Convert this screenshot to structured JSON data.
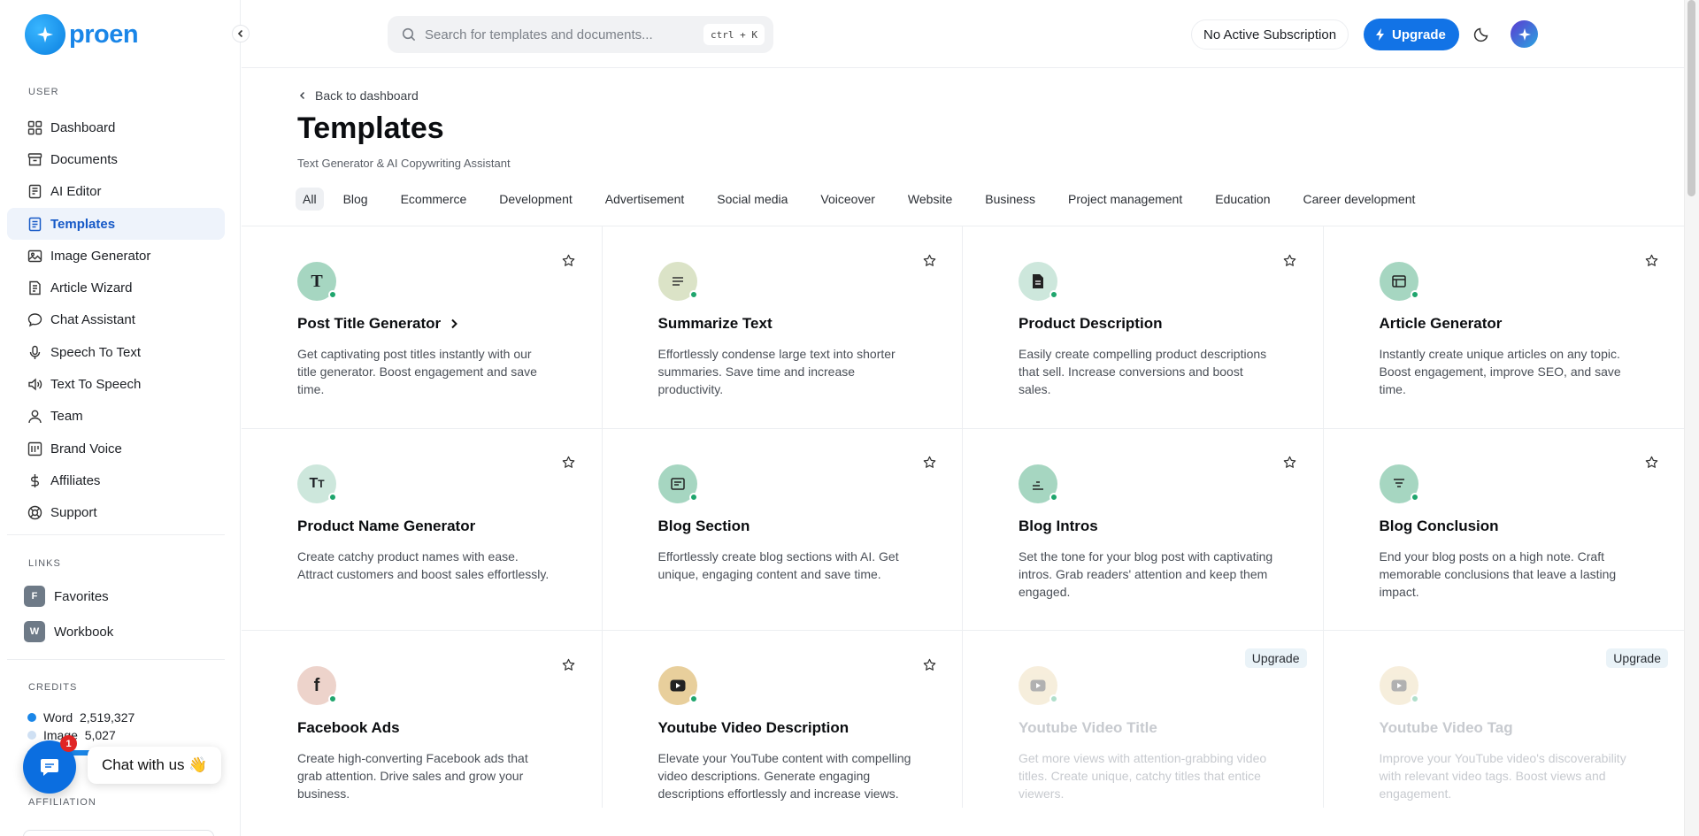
{
  "brand": {
    "name": "proen"
  },
  "sidebar": {
    "user_label": "USER",
    "items": [
      {
        "label": "Dashboard",
        "icon": "dashboard-icon"
      },
      {
        "label": "Documents",
        "icon": "documents-icon"
      },
      {
        "label": "AI Editor",
        "icon": "editor-icon"
      },
      {
        "label": "Templates",
        "icon": "templates-icon",
        "active": true
      },
      {
        "label": "Image Generator",
        "icon": "image-icon"
      },
      {
        "label": "Article Wizard",
        "icon": "wizard-icon"
      },
      {
        "label": "Chat Assistant",
        "icon": "chat-icon"
      },
      {
        "label": "Speech To Text",
        "icon": "mic-icon"
      },
      {
        "label": "Text To Speech",
        "icon": "speaker-icon"
      },
      {
        "label": "Team",
        "icon": "team-icon"
      },
      {
        "label": "Brand Voice",
        "icon": "brand-icon"
      },
      {
        "label": "Affiliates",
        "icon": "dollar-icon"
      },
      {
        "label": "Support",
        "icon": "support-icon"
      }
    ],
    "links_label": "LINKS",
    "links": [
      {
        "badge": "F",
        "label": "Favorites"
      },
      {
        "badge": "W",
        "label": "Workbook"
      }
    ],
    "credits_label": "CREDITS",
    "credits": [
      {
        "label": "Word",
        "value": "2,519,327",
        "color": "#1a86e8"
      },
      {
        "label": "Image",
        "value": "5,027",
        "color": "#cfe0f3"
      }
    ],
    "credit_fill_fraction": 0.55,
    "affiliation_label": "AFFILIATION"
  },
  "chat": {
    "label": "Chat with us 👋",
    "count": "1"
  },
  "header": {
    "search_placeholder": "Search for templates and documents...",
    "shortcut": "ctrl + K",
    "subscription": "No Active Subscription",
    "upgrade": "Upgrade"
  },
  "main": {
    "back": "Back to dashboard",
    "title": "Templates",
    "subtitle": "Text Generator & AI Copywriting Assistant",
    "filters": [
      "All",
      "Blog",
      "Ecommerce",
      "Development",
      "Advertisement",
      "Social media",
      "Voiceover",
      "Website",
      "Business",
      "Project management",
      "Education",
      "Career development"
    ],
    "cards": [
      {
        "title": "Post Title Generator",
        "desc": "Get captivating post titles instantly with our title generator. Boost engagement and save time.",
        "icon": "letter-t-icon",
        "bg": "#a6d6c1",
        "locked": false
      },
      {
        "title": "Summarize Text",
        "desc": "Effortlessly condense large text into shorter summaries. Save time and increase productivity.",
        "icon": "lines-icon",
        "bg": "#dbe3c7",
        "locked": false
      },
      {
        "title": "Product Description",
        "desc": "Easily create compelling product descriptions that sell. Increase conversions and boost sales.",
        "icon": "document-icon",
        "bg": "#cde7dc",
        "locked": false
      },
      {
        "title": "Article Generator",
        "desc": "Instantly create unique articles on any topic. Boost engagement, improve SEO, and save time.",
        "icon": "article-icon",
        "bg": "#a6d6c1",
        "locked": false
      },
      {
        "title": "Product Name Generator",
        "desc": "Create catchy product names with ease. Attract customers and boost sales effortlessly.",
        "icon": "text-size-icon",
        "bg": "#cde7dc",
        "locked": false
      },
      {
        "title": "Blog Section",
        "desc": "Effortlessly create blog sections with AI. Get unique, engaging content and save time.",
        "icon": "blog-icon",
        "bg": "#a6d6c1",
        "locked": false
      },
      {
        "title": "Blog Intros",
        "desc": "Set the tone for your blog post with captivating intros. Grab readers' attention and keep them engaged.",
        "icon": "align-icon",
        "bg": "#a6d6c1",
        "locked": false
      },
      {
        "title": "Blog Conclusion",
        "desc": "End your blog posts on a high note. Craft memorable conclusions that leave a lasting impact.",
        "icon": "filter-lines-icon",
        "bg": "#a6d6c1",
        "locked": false
      },
      {
        "title": "Facebook Ads",
        "desc": "Create high-converting Facebook ads that grab attention. Drive sales and grow your business.",
        "icon": "facebook-icon",
        "bg": "#edd3cb",
        "locked": false
      },
      {
        "title": "Youtube Video Description",
        "desc": "Elevate your YouTube content with compelling video descriptions. Generate engaging descriptions effortlessly and increase views.",
        "icon": "youtube-icon",
        "bg": "#e8cf9c",
        "locked": false
      },
      {
        "title": "Youtube Video Title",
        "desc": "Get more views with attention-grabbing video titles. Create unique, catchy titles that entice viewers.",
        "icon": "youtube-icon",
        "bg": "#e8cf9c",
        "locked": true,
        "badge": "Upgrade"
      },
      {
        "title": "Youtube Video Tag",
        "desc": "Improve your YouTube video's discoverability with relevant video tags. Boost views and engagement.",
        "icon": "youtube-icon",
        "bg": "#e8cf9c",
        "locked": true,
        "badge": "Upgrade"
      }
    ]
  },
  "colors": {
    "accent": "#1273e6",
    "active_nav_bg": "#eef3fb",
    "status_dot": "#1fa56d"
  }
}
